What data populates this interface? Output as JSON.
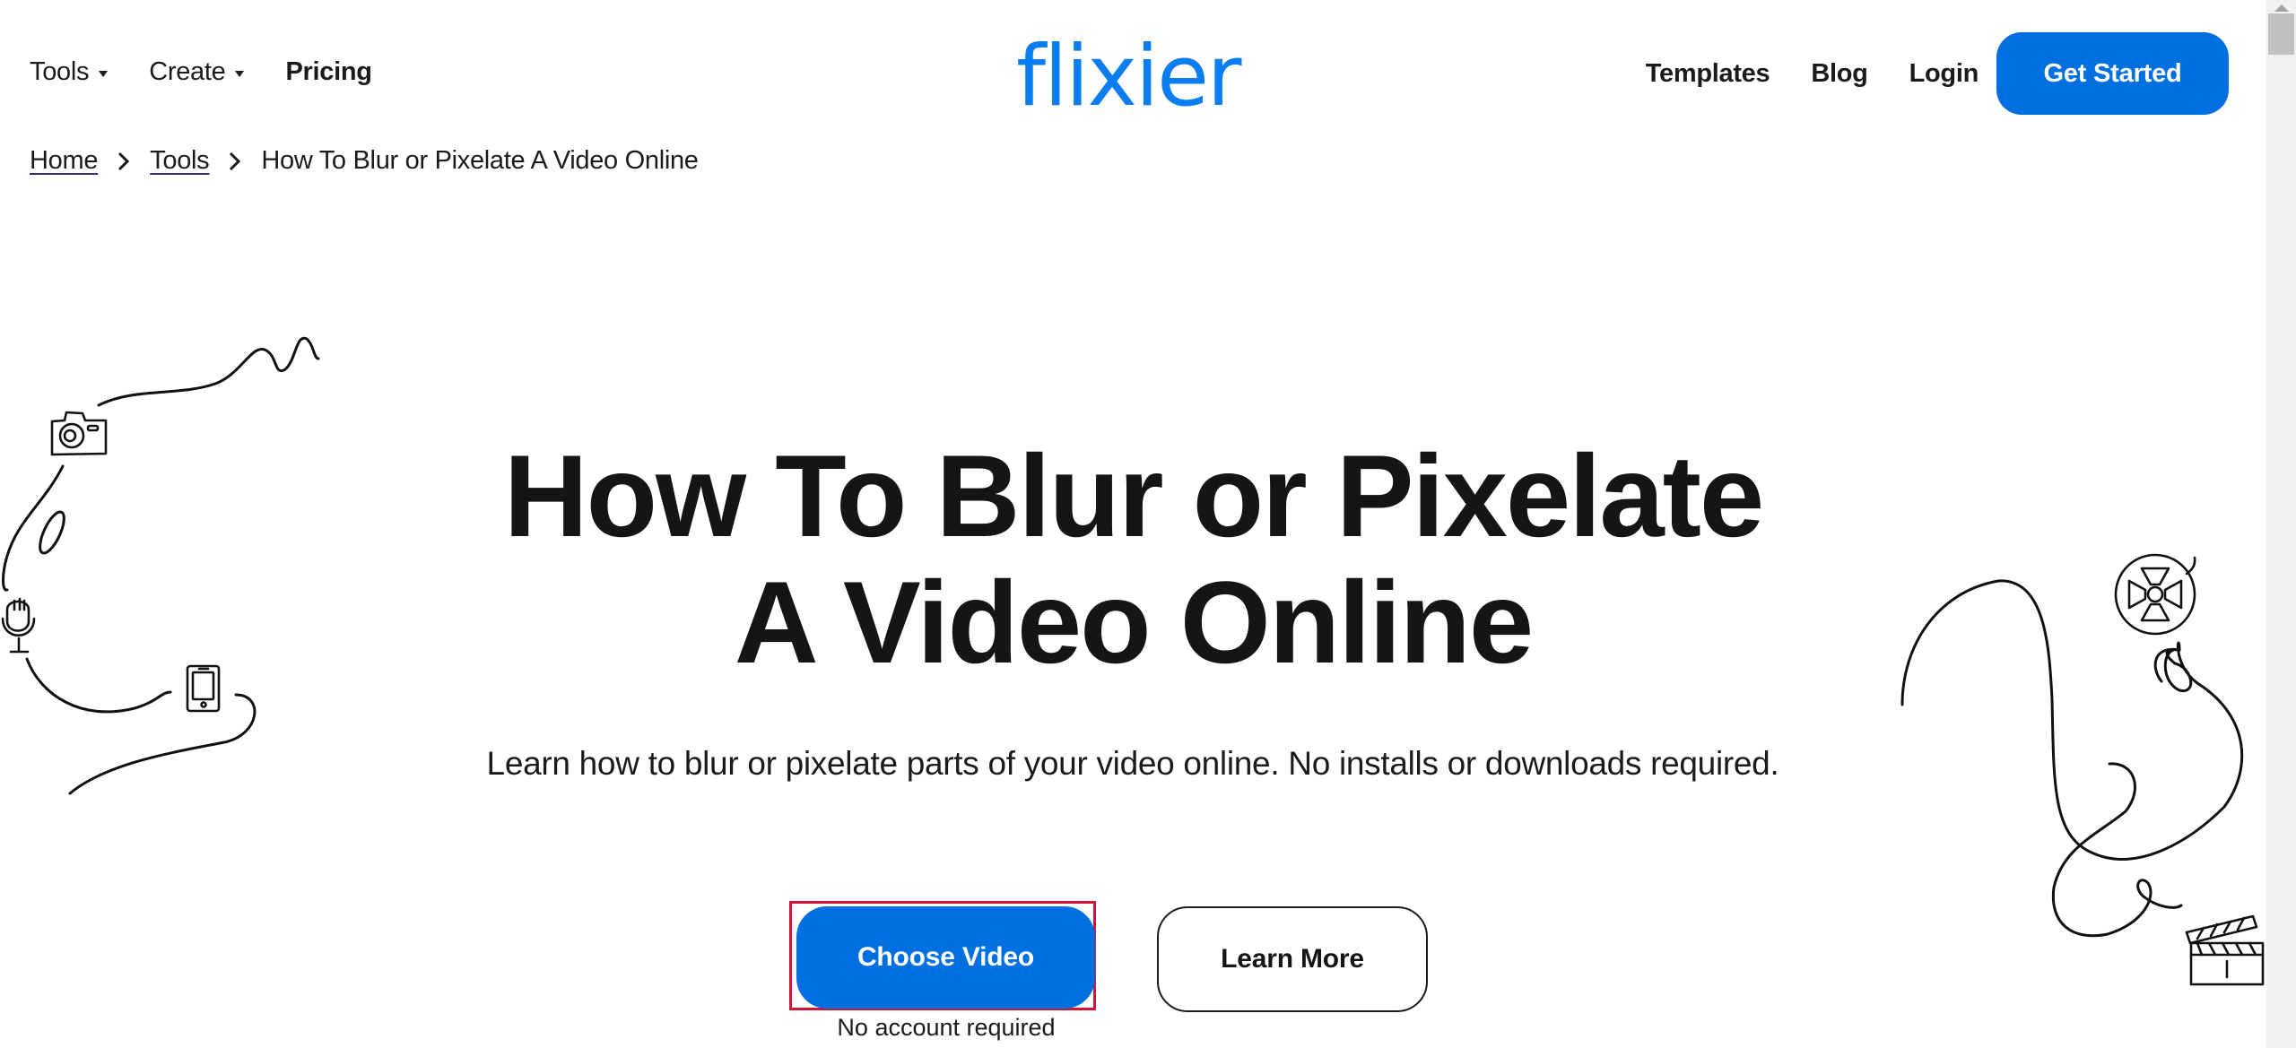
{
  "header": {
    "nav_left": [
      {
        "label": "Tools",
        "has_dropdown": true
      },
      {
        "label": "Create",
        "has_dropdown": true
      },
      {
        "label": "Pricing",
        "has_dropdown": false
      }
    ],
    "logo_text": "flixier",
    "nav_right": [
      {
        "label": "Templates"
      },
      {
        "label": "Blog"
      },
      {
        "label": "Login"
      }
    ],
    "cta_label": "Get Started"
  },
  "breadcrumb": {
    "items": [
      {
        "label": "Home",
        "link": true
      },
      {
        "label": "Tools",
        "link": true
      },
      {
        "label": "How To Blur or Pixelate A Video Online",
        "link": false
      }
    ]
  },
  "hero": {
    "title_line1": "How To Blur or Pixelate",
    "title_line2": "A Video Online",
    "subtitle": "Learn how to blur or pixelate parts of your video online. No installs or downloads required.",
    "primary_button": "Choose Video",
    "secondary_button": "Learn More",
    "note": "No account required"
  },
  "doodles": {
    "left_icons": [
      "camera-icon",
      "microphone-icon",
      "smartphone-icon"
    ],
    "right_icons": [
      "film-reel-icon",
      "clapperboard-icon"
    ]
  },
  "colors": {
    "brand_blue": "#0070e0",
    "logo_blue": "#0a7df0",
    "highlight_outline": "#d0143a",
    "text": "#151515"
  }
}
